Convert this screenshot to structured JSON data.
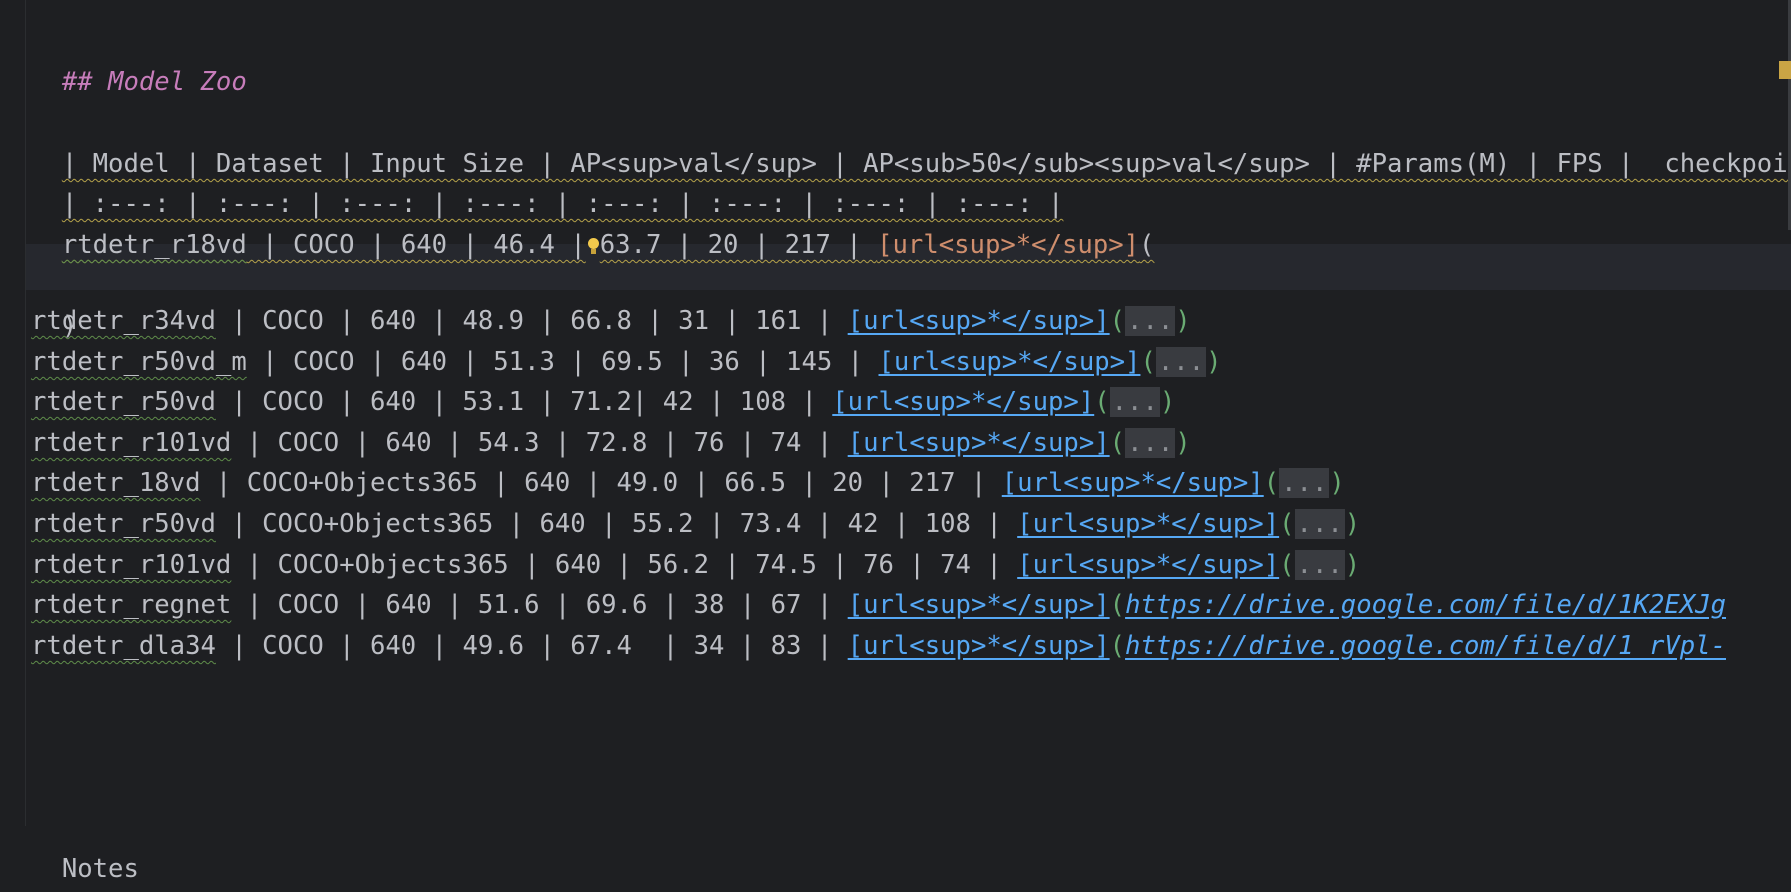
{
  "heading": "## Model Zoo",
  "header_row": "| Model | Dataset | Input Size | AP<sup>val</sup> | AP<sub>50</sub><sup>val</sup> | #Params(M) | FPS |  checkpoint |",
  "divider_row": "| :---: | :---: | :---: | :---: | :---: | :---: | :---: | :---: |",
  "first_row": {
    "model": "rtdetr_r18vd",
    "rest_before_bulb": " | COCO | 640 | 46.4 |",
    "rest_after_bulb": "63.7 | 20 | 217 | ",
    "url_label": "[url<sup>*</sup>]",
    "open_paren": "("
  },
  "closing_paren": ")",
  "rows": [
    {
      "model": "rtdetr_r34vd",
      "cells": " | COCO | 640 | 48.9 | 66.8 | 31 | 161 | ",
      "link": "[url<sup>*</sup>]",
      "folded": "...",
      "url": ""
    },
    {
      "model": "rtdetr_r50vd_m",
      "cells": " | COCO | 640 | 51.3 | 69.5 | 36 | 145 | ",
      "link": "[url<sup>*</sup>]",
      "folded": "...",
      "url": ""
    },
    {
      "model": "rtdetr_r50vd",
      "cells": " | COCO | 640 | 53.1 | 71.2| 42 | 108 | ",
      "link": "[url<sup>*</sup>]",
      "folded": "...",
      "url": ""
    },
    {
      "model": "rtdetr_r101vd",
      "cells": " | COCO | 640 | 54.3 | 72.8 | 76 | 74 | ",
      "link": "[url<sup>*</sup>]",
      "folded": "...",
      "url": ""
    },
    {
      "model": "rtdetr_18vd",
      "cells": " | COCO+Objects365 | 640 | 49.0 | 66.5 | 20 | 217 | ",
      "link": "[url<sup>*</sup>]",
      "folded": "...",
      "url": ""
    },
    {
      "model": "rtdetr_r50vd",
      "cells": " | COCO+Objects365 | 640 | 55.2 | 73.4 | 42 | 108 | ",
      "link": "[url<sup>*</sup>]",
      "folded": "...",
      "url": ""
    },
    {
      "model": "rtdetr_r101vd",
      "cells": " | COCO+Objects365 | 640 | 56.2 | 74.5 | 76 | 74 | ",
      "link": "[url<sup>*</sup>]",
      "folded": "...",
      "url": ""
    },
    {
      "model": "rtdetr_regnet",
      "cells": " | COCO | 640 | 51.6 | 69.6 | 38 | 67 | ",
      "link": "[url<sup>*</sup>]",
      "folded": "",
      "url": "https://drive.google.com/file/d/1K2EXJg"
    },
    {
      "model": "rtdetr_dla34",
      "cells": " | COCO | 640 | 49.6 | 67.4  | 34 | 83 | ",
      "link": "[url<sup>*</sup>]",
      "folded": "",
      "url": "https://drive.google.com/file/d/1_rVpl-"
    }
  ],
  "notes": "Notes"
}
